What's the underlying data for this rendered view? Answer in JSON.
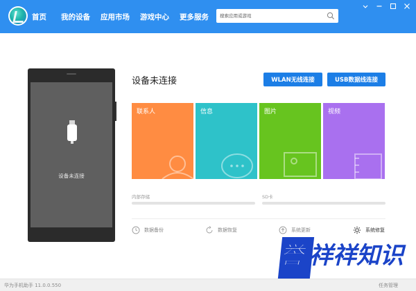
{
  "app": {
    "name": "华为手机助手",
    "version_text": "华为手机助手 11.0.0.550"
  },
  "nav": {
    "items": [
      {
        "label": "首页",
        "active": true
      },
      {
        "label": "我的设备",
        "active": false
      },
      {
        "label": "应用市场",
        "active": false
      },
      {
        "label": "游戏中心",
        "active": false
      },
      {
        "label": "更多服务",
        "active": false
      }
    ]
  },
  "search": {
    "placeholder": "搜索应用或游戏",
    "icon": "search-icon"
  },
  "window_controls": [
    "menu-icon",
    "minimize-icon",
    "maximize-icon",
    "close-icon"
  ],
  "phone": {
    "status_label": "设备未连接"
  },
  "connection": {
    "title": "设备未连接",
    "wlan_button": "WLAN无线连接",
    "usb_button": "USB数据线连接"
  },
  "tiles": [
    {
      "label": "联系人",
      "color": "#ff8c42",
      "icon": "contacts-icon"
    },
    {
      "label": "信息",
      "color": "#2ec2c9",
      "icon": "message-icon"
    },
    {
      "label": "图片",
      "color": "#67c41f",
      "icon": "picture-icon"
    },
    {
      "label": "视频",
      "color": "#a970ef",
      "icon": "video-icon"
    }
  ],
  "storage": {
    "internal_label": "内部存储",
    "sd_label": "SD卡"
  },
  "tools": [
    {
      "label": "数据备份",
      "icon": "backup-icon"
    },
    {
      "label": "数据恢复",
      "icon": "restore-icon"
    },
    {
      "label": "系统更新",
      "icon": "update-icon"
    },
    {
      "label": "系统修复",
      "icon": "repair-icon"
    }
  ],
  "statusbar": {
    "task_manager": "任务管理"
  },
  "watermark": {
    "text": "誉祥祥知识",
    "first_char": "誉",
    "rest": "祥祥知识"
  },
  "colors": {
    "topbar": "#2f8ff0",
    "button": "#1c7ee6",
    "watermark": "#1b44c8"
  }
}
